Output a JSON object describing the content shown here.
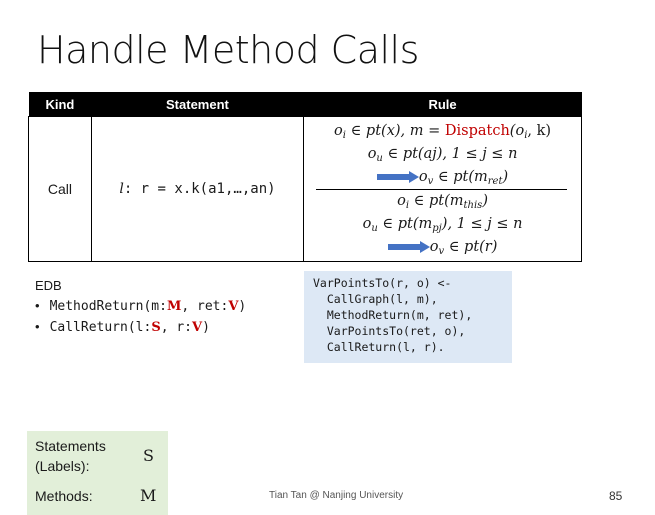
{
  "title": "Handle Method Calls",
  "table": {
    "headers": [
      "Kind",
      "Statement",
      "Rule"
    ],
    "kind": "Call",
    "statement_label": "l",
    "statement_rest": ": r = x.k(a1,…,an)",
    "rule": {
      "line1_a": "o",
      "line1_a_sub": "i",
      "line1_b": " ∈ pt(x),  m = ",
      "line1_dispatch": "Dispatch",
      "line1_c": "(o",
      "line1_c_sub": "i",
      "line1_d": ", k)",
      "line2": "o",
      "line2_sub": "u",
      "line2_b": " ∈ pt(aj), 1 ≤ j ≤ n",
      "line3": "o",
      "line3_sub": "v",
      "line3_b": " ∈ pt(m",
      "line3_sub2": "ret",
      "line3_c": ")",
      "line4": "o",
      "line4_sub": "i",
      "line4_b": " ∈ pt(m",
      "line4_sub2": "this",
      "line4_c": ")",
      "line5": "o",
      "line5_sub": "u",
      "line5_b": " ∈ pt(m",
      "line5_sub2": "pj",
      "line5_c": "), 1 ≤ j ≤ n",
      "line6": "o",
      "line6_sub": "v",
      "line6_b": " ∈ pt(r)"
    }
  },
  "edb": {
    "title": "EDB",
    "items": [
      {
        "a": "MethodReturn(m:",
        "t1": "M",
        "b": ", ret:",
        "t2": "V",
        "c": ")"
      },
      {
        "a": "CallReturn(l:",
        "t1": "S",
        "b": ", r:",
        "t2": "V",
        "c": ")"
      }
    ]
  },
  "code": [
    "VarPointsTo(r, o) <-",
    "  CallGraph(l, m),",
    "  MethodReturn(m, ret),",
    "  VarPointsTo(ret, o),",
    "  CallReturn(l, r)."
  ],
  "legend": {
    "statements_label_1": "Statements",
    "statements_label_2": "(Labels):",
    "statements_symbol": "S",
    "methods_label": "Methods:",
    "methods_symbol": "M"
  },
  "footer": "Tian Tan @ Nanjing University",
  "page_number": "85",
  "colors": {
    "accent_red": "#c00000",
    "arrow_blue": "#4472c4",
    "code_bg": "#dde8f5",
    "legend_bg": "#e2efd9"
  }
}
